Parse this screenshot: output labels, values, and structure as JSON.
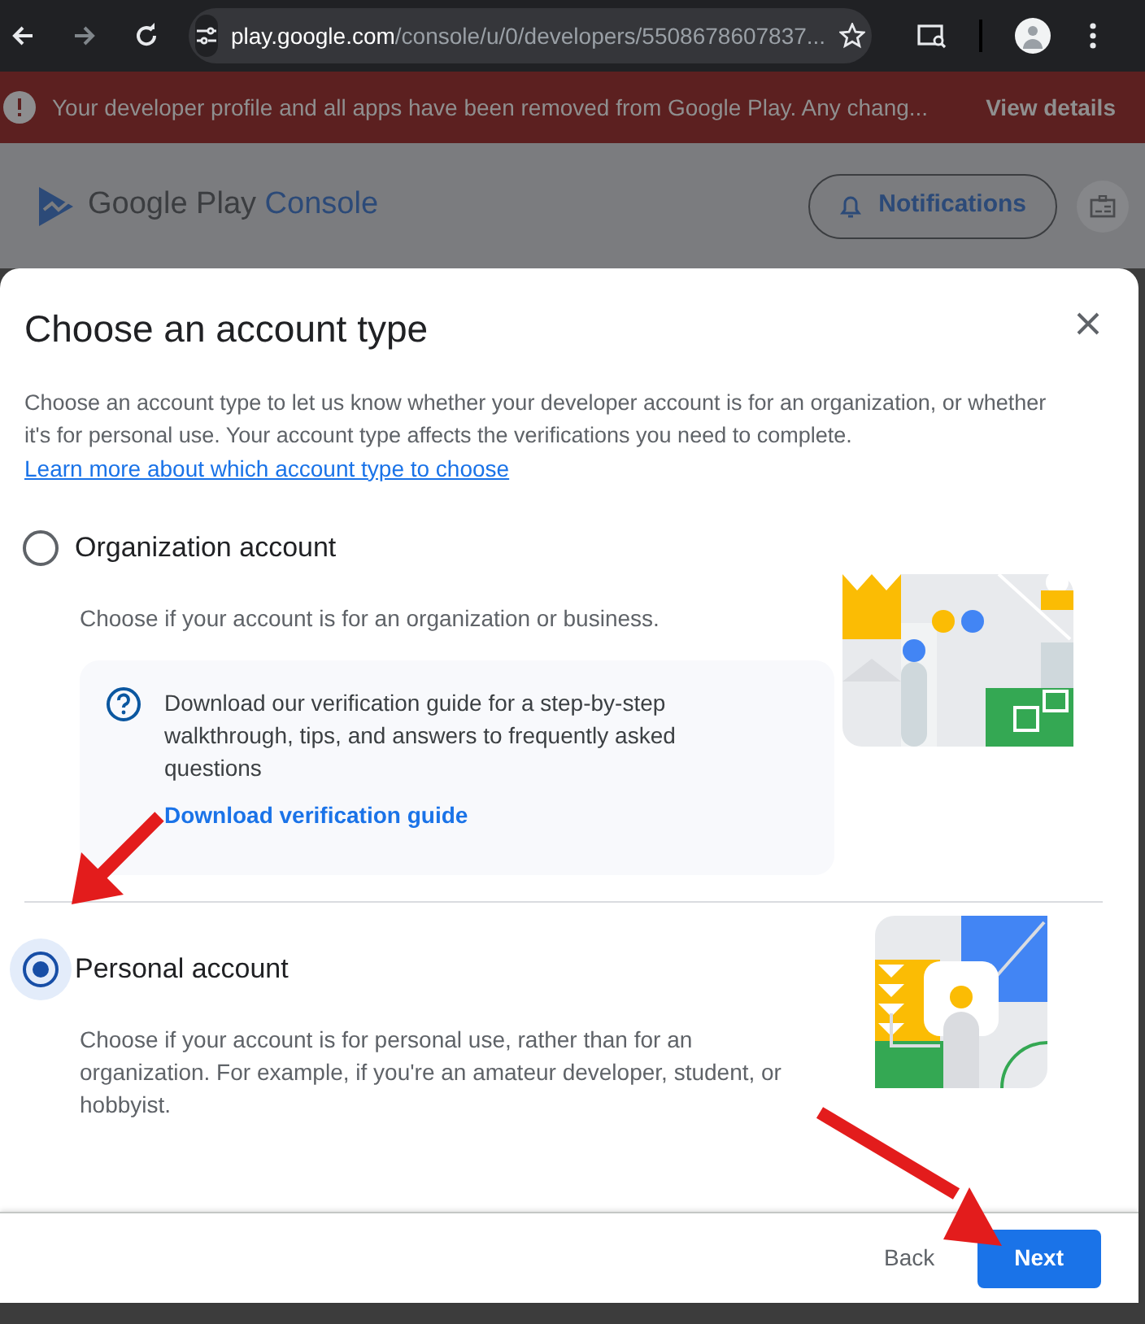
{
  "browser": {
    "url_host": "play.google.com",
    "url_path": "/console/u/0/developers/5508678607837..."
  },
  "banner": {
    "text": "Your developer profile and all apps have been removed from Google Play. Any chang...",
    "action": "View details"
  },
  "header": {
    "logo_text": "Google Play",
    "logo_accent": "Console",
    "notifications": "Notifications"
  },
  "dialog": {
    "title": "Choose an account type",
    "description": "Choose an account type to let us know whether your developer account is for an organization, or whether it's for personal use. Your account type affects the verifications you need to complete.",
    "link": "Learn more about which account type to choose",
    "options": [
      {
        "title": "Organization account",
        "description": "Choose if your account is for an organization or business.",
        "selected": false,
        "help": {
          "text": "Download our verification guide for a step-by-step walkthrough, tips, and answers to frequently asked questions",
          "link": "Download verification guide"
        }
      },
      {
        "title": "Personal account",
        "description": "Choose if your account is for personal use, rather than for an organization. For example, if you're an amateur developer, student, or hobbyist.",
        "selected": true
      }
    ],
    "buttons": [
      {
        "label": "Back",
        "kind": "text"
      },
      {
        "label": "Next",
        "kind": "primary"
      }
    ]
  }
}
